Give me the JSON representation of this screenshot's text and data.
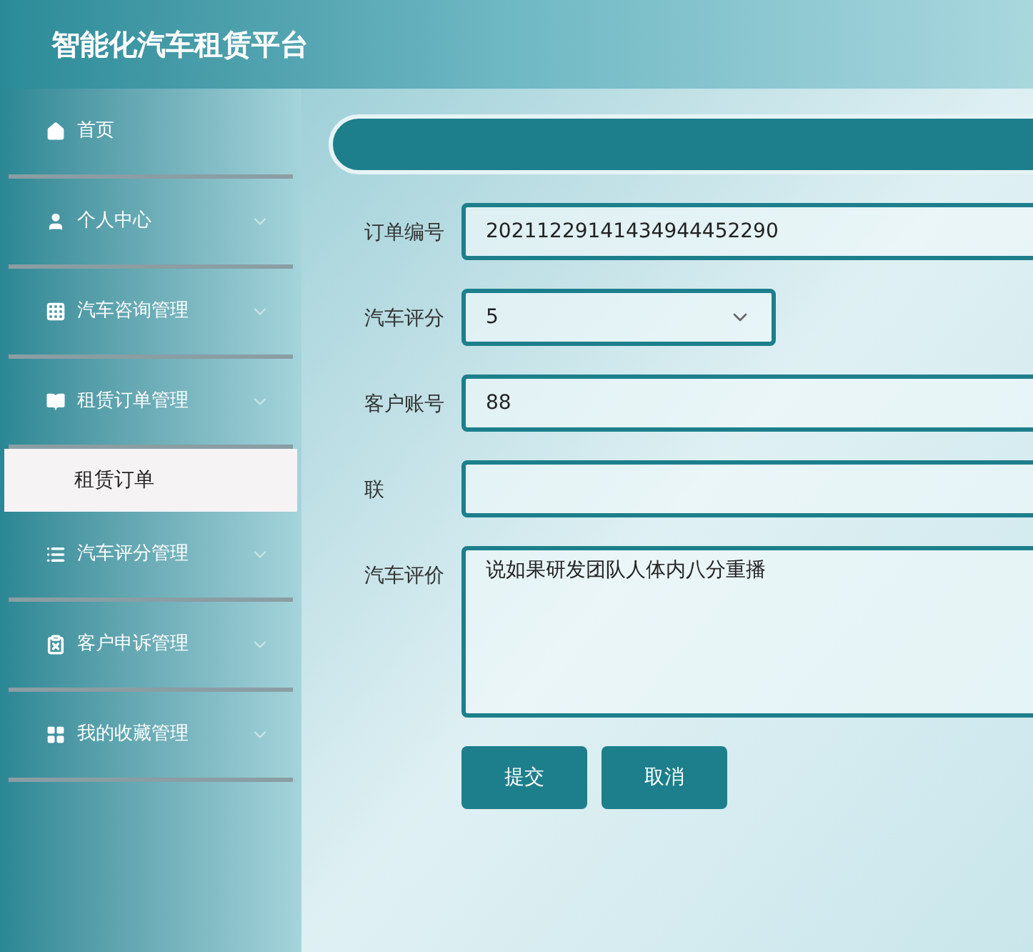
{
  "header": {
    "title": "智能化汽车租赁平台"
  },
  "sidebar": {
    "items": [
      {
        "label": "首页",
        "expandable": false
      },
      {
        "label": "个人中心",
        "expandable": true
      },
      {
        "label": "汽车咨询管理",
        "expandable": true
      },
      {
        "label": "租赁订单管理",
        "expandable": true,
        "children": [
          {
            "label": "租赁订单",
            "selected": true
          }
        ]
      },
      {
        "label": "汽车评分管理",
        "expandable": true
      },
      {
        "label": "客户申诉管理",
        "expandable": true
      },
      {
        "label": "我的收藏管理",
        "expandable": true
      }
    ]
  },
  "form": {
    "fields": [
      {
        "kind": "text",
        "label": "订单编号",
        "value": "20211229141434944452290"
      },
      {
        "kind": "select",
        "label": "汽车评分",
        "value": "5"
      },
      {
        "kind": "text",
        "label": "客户账号",
        "value": "88"
      },
      {
        "kind": "text",
        "label": "联"
      },
      {
        "kind": "textarea",
        "label": "汽车评价",
        "value": "说如果研发团队人体内八分重播"
      }
    ],
    "buttons": [
      "提交",
      "取消"
    ]
  }
}
